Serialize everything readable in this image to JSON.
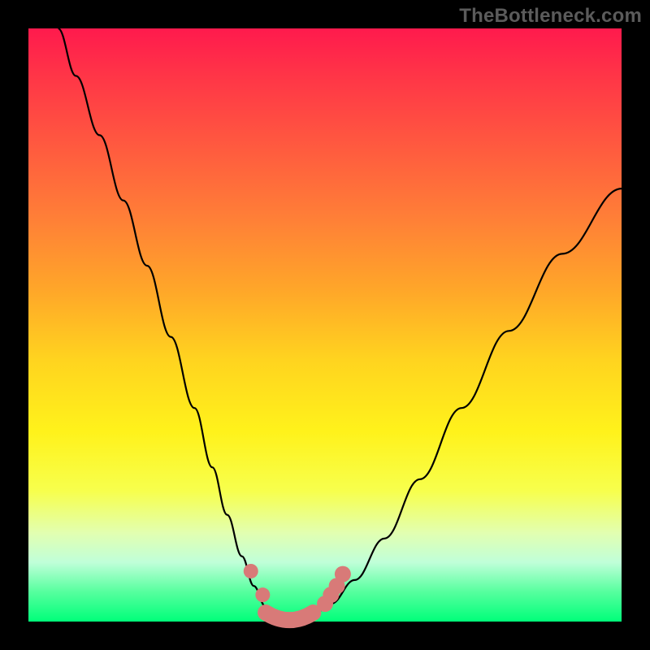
{
  "watermark": "TheBottleneck.com",
  "colors": {
    "gradient_top": "#ff1a4d",
    "gradient_mid": "#ffd41f",
    "gradient_bottom": "#00ff7a",
    "curve": "#000000",
    "markers": "#d87a78",
    "frame": "#000000"
  },
  "chart_data": {
    "type": "line",
    "title": "",
    "xlabel": "",
    "ylabel": "",
    "xlim": [
      0,
      100
    ],
    "ylim": [
      0,
      100
    ],
    "grid": false,
    "legend": false,
    "series": [
      {
        "name": "bottleneck-curve",
        "x": [
          5,
          8,
          12,
          16,
          20,
          24,
          28,
          31,
          33.5,
          36,
          38,
          40,
          42,
          44,
          46,
          48,
          51,
          55,
          60,
          66,
          73,
          81,
          90,
          100
        ],
        "y": [
          100,
          92,
          82,
          71,
          60,
          48,
          36,
          26,
          18,
          11,
          6,
          2.5,
          0.5,
          0,
          0.3,
          1.2,
          3,
          7,
          14,
          24,
          36,
          49,
          62,
          73
        ]
      }
    ],
    "annotations": {
      "minimum_region_x": [
        40,
        48
      ],
      "marker_points_x": [
        37.5,
        39.5,
        50,
        51,
        52,
        53
      ],
      "marker_points_y": [
        8.5,
        4.5,
        3,
        4.5,
        6,
        8
      ]
    }
  }
}
